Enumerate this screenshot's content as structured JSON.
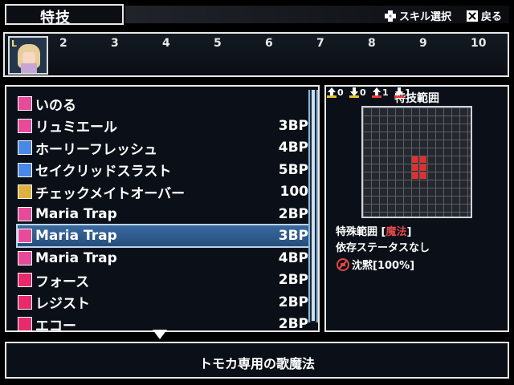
{
  "header": {
    "title": "特技"
  },
  "hints": [
    {
      "icon": "dpad-icon",
      "label": "スキル選択"
    },
    {
      "icon": "cancel-key-icon",
      "label": "戻る"
    }
  ],
  "party": {
    "level_badge": "L",
    "slots": [
      "2",
      "3",
      "4",
      "5",
      "6",
      "7",
      "8",
      "9",
      "10"
    ]
  },
  "skills": [
    {
      "name": "いのる",
      "cost": "",
      "icon": "prayer-icon",
      "icon_color": "#e84a9a"
    },
    {
      "name": "リュミエール",
      "cost": "3BP",
      "icon": "light-spell-icon",
      "icon_color": "#e84a9a"
    },
    {
      "name": "ホーリーフレッシュ",
      "cost": "4BP",
      "icon": "holy-spell-icon",
      "icon_color": "#4a88e8"
    },
    {
      "name": "セイクリッドスラスト",
      "cost": "5BP",
      "icon": "thrust-icon",
      "icon_color": "#4a88e8"
    },
    {
      "name": "チェックメイトオーバー",
      "cost": "100",
      "icon": "checkmate-icon",
      "icon_color": "#e0b040"
    },
    {
      "name": "Maria Trap",
      "cost": "2BP",
      "icon": "note-icon",
      "icon_color": "#e84a9a"
    },
    {
      "name": "Maria Trap",
      "cost": "3BP",
      "icon": "note-plus-icon",
      "icon_color": "#e84a9a"
    },
    {
      "name": "Maria Trap",
      "cost": "4BP",
      "icon": "note-double-icon",
      "icon_color": "#e84a9a"
    },
    {
      "name": "フォース",
      "cost": "2BP",
      "icon": "vo-force-icon",
      "icon_color": "#e82a6a"
    },
    {
      "name": "レジスト",
      "cost": "2BP",
      "icon": "vo-resist-icon",
      "icon_color": "#e82a6a"
    },
    {
      "name": "エコー",
      "cost": "2BP",
      "icon": "vo-echo-icon",
      "icon_color": "#e82a6a"
    }
  ],
  "selected_index": 6,
  "range": {
    "title": "特技範囲",
    "modifiers": [
      {
        "icon": "stat-up-icon",
        "value": "0",
        "color": "#e8c030"
      },
      {
        "icon": "stat-down-icon",
        "value": "0",
        "color": "#e8c030"
      },
      {
        "icon": "stat-up-icon",
        "value": "1",
        "color": "#e83a3a"
      },
      {
        "icon": "stat-down-icon",
        "value": "1",
        "color": "#e83a3a"
      }
    ],
    "special_range_label": "特殊範囲 [",
    "special_range_value": "魔法",
    "special_range_close": "]",
    "dependency": "依存ステータスなし",
    "effect": "沈黙[100%]",
    "effect_icon": "silence-icon",
    "accent_color": "#e04848"
  },
  "description": "トモカ専用の歌魔法"
}
